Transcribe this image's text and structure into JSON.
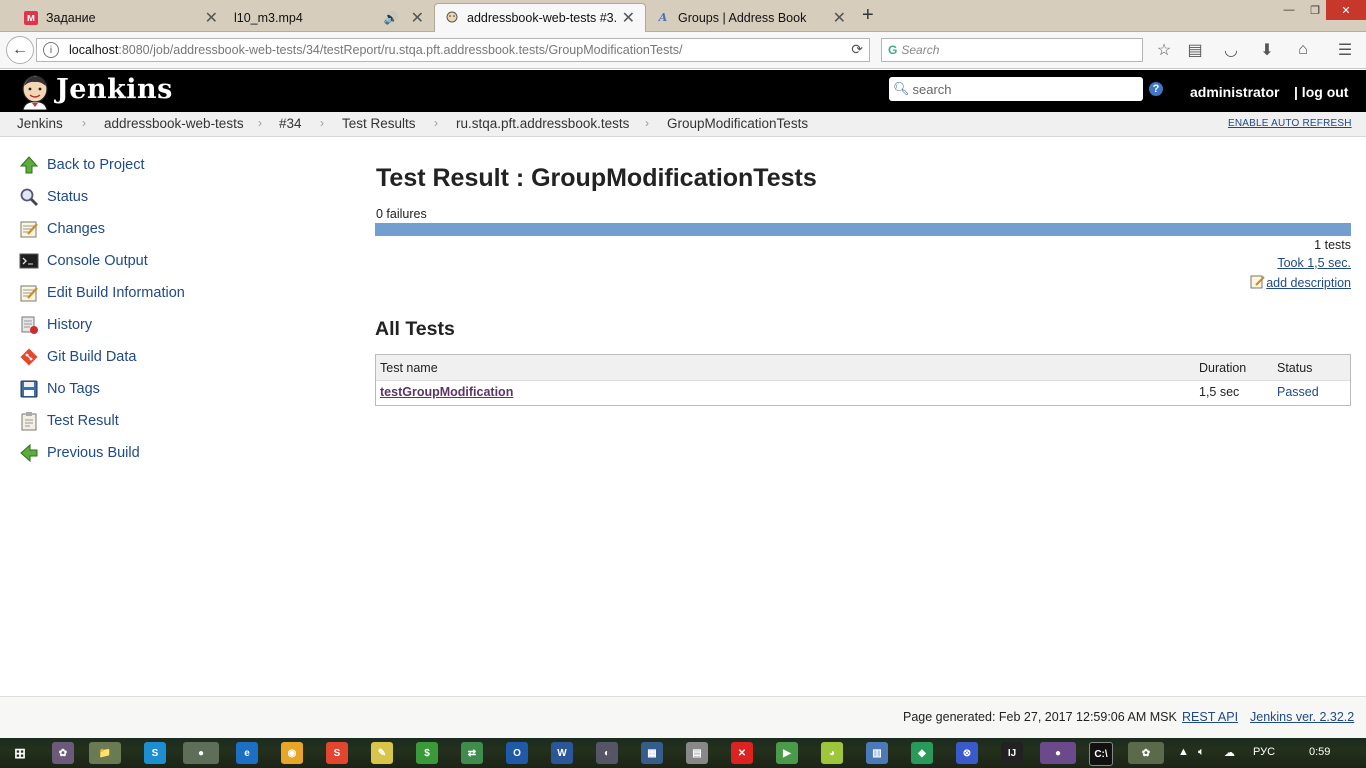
{
  "browser": {
    "tabs": [
      {
        "title": "Задание",
        "favicon": "м",
        "favicon_color": "#e0334c"
      },
      {
        "title": "l10_m3.mp4",
        "favicon": "",
        "audio_icon": "speaker-icon"
      },
      {
        "title": "addressbook-web-tests #3...",
        "favicon": "jenkins-face-icon"
      },
      {
        "title": "Groups | Address Book",
        "favicon": "A"
      }
    ],
    "new_tab": "+",
    "url_host": "localhost",
    "url_path": ":8080/job/addressbook-web-tests/34/testReport/ru.stqa.pft.addressbook.tests/GroupModificationTests/",
    "search_placeholder": "Search"
  },
  "jenkins": {
    "brand": "Jenkins",
    "search_placeholder": "search",
    "help": "?",
    "user": "administrator",
    "logout": "| log out"
  },
  "breadcrumbs": [
    "Jenkins",
    "addressbook-web-tests",
    "#34",
    "Test Results",
    "ru.stqa.pft.addressbook.tests",
    "GroupModificationTests"
  ],
  "breadcrumb_separator": "›",
  "auto_refresh": "ENABLE AUTO REFRESH",
  "sidebar": [
    {
      "label": "Back to Project",
      "icon": "up-arrow-icon"
    },
    {
      "label": "Status",
      "icon": "magnifier-icon"
    },
    {
      "label": "Changes",
      "icon": "notepad-icon"
    },
    {
      "label": "Console Output",
      "icon": "terminal-icon"
    },
    {
      "label": "Edit Build Information",
      "icon": "notepad-edit-icon"
    },
    {
      "label": "History",
      "icon": "history-icon"
    },
    {
      "label": "Git Build Data",
      "icon": "git-icon"
    },
    {
      "label": "No Tags",
      "icon": "save-icon"
    },
    {
      "label": "Test Result",
      "icon": "clipboard-icon"
    },
    {
      "label": "Previous Build",
      "icon": "left-arrow-icon"
    }
  ],
  "main": {
    "title": "Test Result : GroupModificationTests",
    "failures": "0 failures",
    "pass_fraction": 1.0,
    "tests": "1 tests",
    "took": "Took 1,5 sec.",
    "add_description": "add description",
    "all_tests": "All Tests",
    "table": {
      "headers": [
        "Test name",
        "Duration",
        "Status"
      ],
      "rows": [
        {
          "name": "testGroupModification",
          "duration": "1,5 sec",
          "status": "Passed"
        }
      ]
    }
  },
  "footer": {
    "generated": "Page generated: Feb 27, 2017 12:59:06 AM MSK",
    "rest_api": "REST API",
    "version": "Jenkins ver. 2.32.2"
  },
  "taskbar": {
    "lang": "РУС",
    "time": "0:59"
  },
  "colors": {
    "link": "#204a87",
    "progress": "#729fcf",
    "header_bg": "#000000"
  }
}
